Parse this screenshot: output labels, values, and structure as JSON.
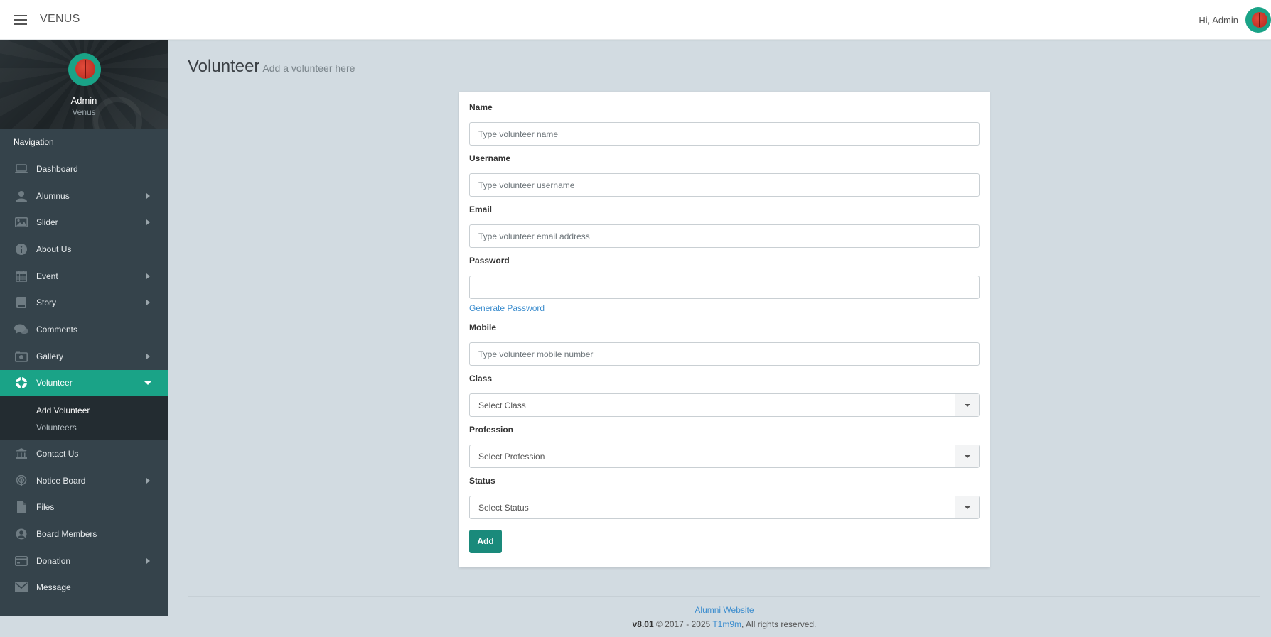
{
  "topbar": {
    "brand": "VENUS",
    "greeting": "Hi, Admin"
  },
  "profile": {
    "name": "Admin",
    "subtitle": "Venus"
  },
  "sidebar": {
    "header": "Navigation",
    "items": [
      {
        "label": "Dashboard",
        "icon": "laptop-icon"
      },
      {
        "label": "Alumnus",
        "icon": "user-icon"
      },
      {
        "label": "Slider",
        "icon": "image-icon"
      },
      {
        "label": "About Us",
        "icon": "info-icon"
      },
      {
        "label": "Event",
        "icon": "calendar-icon"
      },
      {
        "label": "Story",
        "icon": "book-icon"
      },
      {
        "label": "Comments",
        "icon": "comments-icon"
      },
      {
        "label": "Gallery",
        "icon": "camera-icon"
      },
      {
        "label": "Volunteer",
        "icon": "life-ring-icon"
      },
      {
        "label": "Contact Us",
        "icon": "bank-icon"
      },
      {
        "label": "Notice Board",
        "icon": "podcast-icon"
      },
      {
        "label": "Files",
        "icon": "file-icon"
      },
      {
        "label": "Board Members",
        "icon": "user-circle-icon"
      },
      {
        "label": "Donation",
        "icon": "credit-card-icon"
      },
      {
        "label": "Message",
        "icon": "envelope-icon"
      }
    ],
    "submenu": [
      "Add Volunteer",
      "Volunteers"
    ]
  },
  "page": {
    "title": "Volunteer",
    "subtitle": "Add a volunteer here"
  },
  "form": {
    "name_label": "Name",
    "name_placeholder": "Type volunteer name",
    "username_label": "Username",
    "username_placeholder": "Type volunteer username",
    "email_label": "Email",
    "email_placeholder": "Type volunteer email address",
    "password_label": "Password",
    "password_value": "",
    "generate_password": "Generate Password",
    "mobile_label": "Mobile",
    "mobile_placeholder": "Type volunteer mobile number",
    "class_label": "Class",
    "class_value": "Select Class",
    "profession_label": "Profession",
    "profession_value": "Select Profession",
    "status_label": "Status",
    "status_value": "Select Status",
    "submit": "Add"
  },
  "footer": {
    "link": "Alumni Website",
    "version": "v8.01",
    "copyright": "© 2017 - 2025",
    "company": "T1m9m",
    "rights": ", All rights reserved."
  },
  "colors": {
    "accent": "#1aa387",
    "sidebar_bg": "#35434b",
    "page_bg": "#d2dbe1",
    "link": "#3c8dce"
  }
}
